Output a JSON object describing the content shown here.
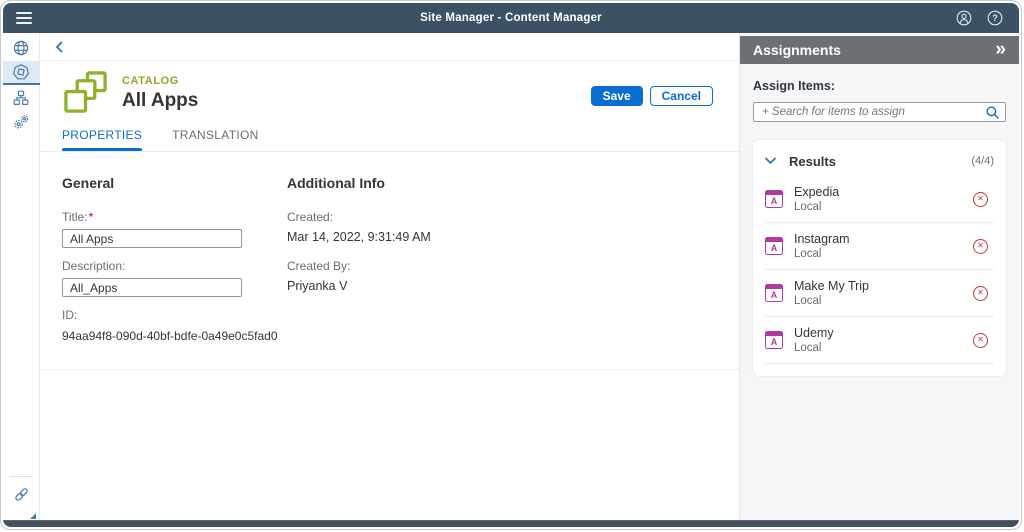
{
  "topbar": {
    "title": "Site Manager - Content Manager"
  },
  "icons": {
    "menu": "hamburger-menu",
    "expand_panel": "»",
    "decline": "✕",
    "help": "?",
    "app_letter": "A"
  },
  "sidebar": {
    "items": [
      {
        "icon": "globe-icon",
        "selected": false
      },
      {
        "icon": "content-package-icon",
        "selected": true
      },
      {
        "icon": "hierarchy-icon",
        "selected": false
      },
      {
        "icon": "settings-gears-icon",
        "selected": false
      }
    ],
    "footer_icon": "link-icon"
  },
  "page_header": {
    "category": "CATALOG",
    "title": "All Apps",
    "save_label": "Save",
    "cancel_label": "Cancel"
  },
  "tabs": [
    {
      "label": "PROPERTIES",
      "active": true
    },
    {
      "label": "TRANSLATION",
      "active": false
    }
  ],
  "form": {
    "general": {
      "heading": "General",
      "title_label": "Title:",
      "required_mark": "*",
      "title_value": "All Apps",
      "description_label": "Description:",
      "description_value": "All_Apps",
      "id_label": "ID:",
      "id_value": "94aa94f8-090d-40bf-bdfe-0a49e0c5fad0"
    },
    "additional": {
      "heading": "Additional Info",
      "created_label": "Created:",
      "created_value": "Mar 14, 2022, 9:31:49 AM",
      "created_by_label": "Created By:",
      "created_by_value": "Priyanka V"
    }
  },
  "assignments": {
    "title": "Assignments",
    "assign_items_label": "Assign Items:",
    "search_placeholder": "+ Search for items to assign",
    "results": {
      "header": "Results",
      "count": "(4/4)",
      "items": [
        {
          "title": "Expedia",
          "subtitle": "Local"
        },
        {
          "title": "Instagram",
          "subtitle": "Local"
        },
        {
          "title": "Make My Trip",
          "subtitle": "Local"
        },
        {
          "title": "Udemy",
          "subtitle": "Local"
        }
      ]
    }
  },
  "colors": {
    "shell_bar": "#3d5164",
    "accent_blue": "#0a6ed1",
    "catalog_green": "#84ad24",
    "panel_header_gray": "#6d7073",
    "app_icon_magenta": "#b13a9e",
    "decline_red": "#c23934"
  }
}
